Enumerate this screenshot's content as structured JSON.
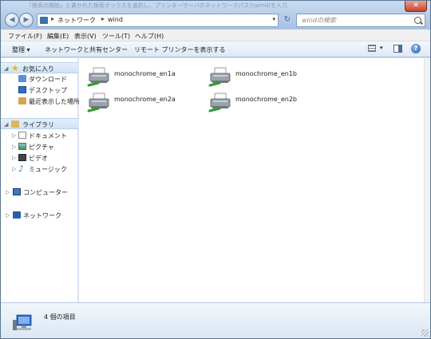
{
  "titlebar": {
    "ghost_text": "「検索の開始」と書かれた検索ボックスを選択し、プリンターサーバのネットワークパス(\\\\wind)を入力",
    "close_glyph": "✕"
  },
  "nav": {
    "back_glyph": "◀",
    "forward_glyph": "▶"
  },
  "address": {
    "separator": "▸",
    "crumbs": [
      "ネットワーク",
      "wind"
    ],
    "dropdown_glyph": "▾",
    "refresh_glyph": "↻"
  },
  "search": {
    "placeholder": "windの検索"
  },
  "menu": {
    "file": "ファイル(F)",
    "edit": "編集(E)",
    "view": "表示(V)",
    "tools": "ツール(T)",
    "help": "ヘルプ(H)"
  },
  "commands": {
    "organize": "整理 ▾",
    "network_center": "ネットワークと共有センター",
    "remote_printers": "リモート プリンターを表示する",
    "views_dropdown": "▾",
    "help_glyph": "?"
  },
  "navpane": {
    "collapse_glyph": "◢",
    "expand_glyph": "▷",
    "favorites": "お気に入り",
    "downloads": "ダウンロード",
    "desktop": "デスクトップ",
    "recent": "最近表示した場所",
    "libraries": "ライブラリ",
    "documents": "ドキュメント",
    "pictures": "ピクチャ",
    "videos": "ビデオ",
    "music": "ミュージック",
    "computer": "コンピューター",
    "network": "ネットワーク"
  },
  "items": [
    {
      "label": "monochrome_en1a",
      "icon": "network-printer-icon"
    },
    {
      "label": "monochrome_en1b",
      "icon": "network-printer-icon"
    },
    {
      "label": "monochrome_en2a",
      "icon": "network-printer-icon"
    },
    {
      "label": "monochrome_en2b",
      "icon": "network-printer-icon"
    }
  ],
  "status": {
    "text": "4 個の項目"
  }
}
